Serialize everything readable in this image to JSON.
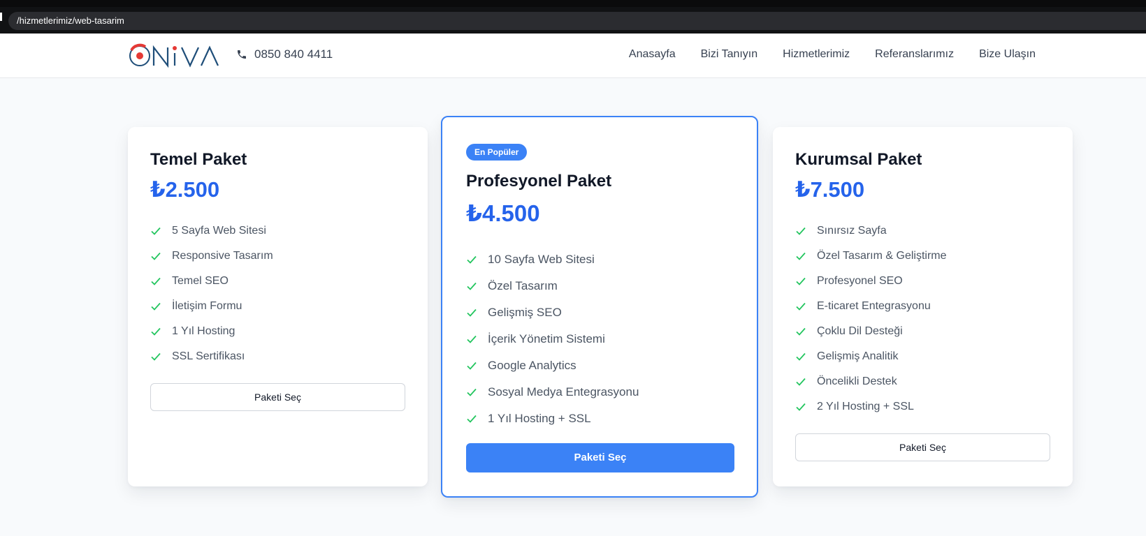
{
  "browser": {
    "url": "/hizmetlerimiz/web-tasarim"
  },
  "header": {
    "logo_text": "ONiVA",
    "phone": "0850 840 4411",
    "nav": [
      "Anasayfa",
      "Bizi Tanıyın",
      "Hizmetlerimiz",
      "Referanslarımız",
      "Bize Ulaşın"
    ]
  },
  "colors": {
    "accent": "#3b82f6",
    "price": "#2563eb",
    "check": "#22c55e",
    "logo_red": "#e53935",
    "logo_blue": "#1f4e79"
  },
  "plans": [
    {
      "title": "Temel Paket",
      "price": "₺2.500",
      "features": [
        "5 Sayfa Web Sitesi",
        "Responsive Tasarım",
        "Temel SEO",
        "İletişim Formu",
        "1 Yıl Hosting",
        "SSL Sertifikası"
      ],
      "button": "Paketi Seç"
    },
    {
      "badge": "En Popüler",
      "title": "Profesyonel Paket",
      "price": "₺4.500",
      "features": [
        "10 Sayfa Web Sitesi",
        "Özel Tasarım",
        "Gelişmiş SEO",
        "İçerik Yönetim Sistemi",
        "Google Analytics",
        "Sosyal Medya Entegrasyonu",
        "1 Yıl Hosting + SSL"
      ],
      "button": "Paketi Seç"
    },
    {
      "title": "Kurumsal Paket",
      "price": "₺7.500",
      "features": [
        "Sınırsız Sayfa",
        "Özel Tasarım & Geliştirme",
        "Profesyonel SEO",
        "E-ticaret Entegrasyonu",
        "Çoklu Dil Desteği",
        "Gelişmiş Analitik",
        "Öncelikli Destek",
        "2 Yıl Hosting + SSL"
      ],
      "button": "Paketi Seç"
    }
  ]
}
